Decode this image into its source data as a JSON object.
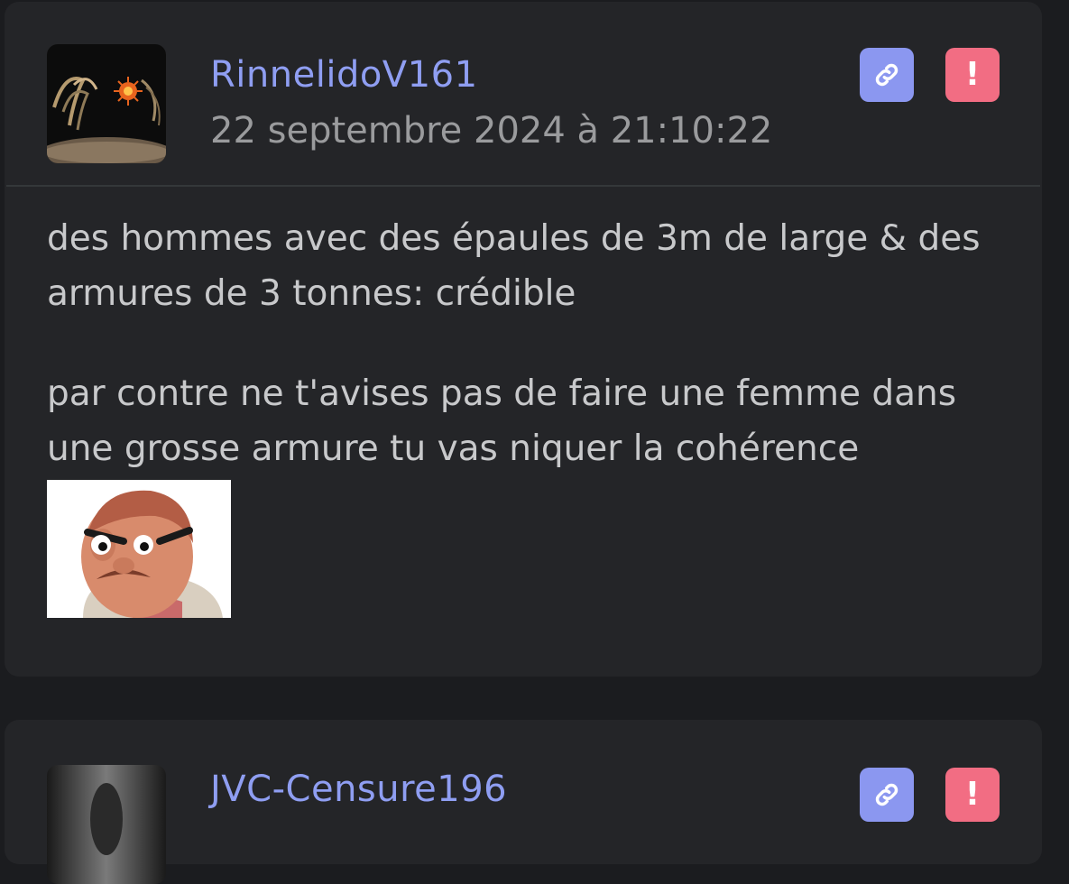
{
  "posts": [
    {
      "username": "RinnelidoV161",
      "date": "22 septembre 2024 à 21:10:22",
      "paragraphs": [
        "des hommes avec des épaules de 3m de large & des armures de 3 tonnes: crédible",
        "par contre ne t'avises pas de faire une femme dans une grosse armure tu vas niquer la cohérence"
      ],
      "link_icon": "link-icon",
      "report_icon": "exclamation-icon",
      "report_label": "!"
    },
    {
      "username": "JVC-Censure196",
      "link_icon": "link-icon",
      "report_icon": "exclamation-icon",
      "report_label": "!"
    }
  ],
  "colors": {
    "background": "#1b1c1f",
    "card": "#242528",
    "username": "#8f9ef2",
    "date": "#9a9b9d",
    "text": "#c8c9cb",
    "link_button": "#8b97f0",
    "report_button": "#f26d83"
  }
}
